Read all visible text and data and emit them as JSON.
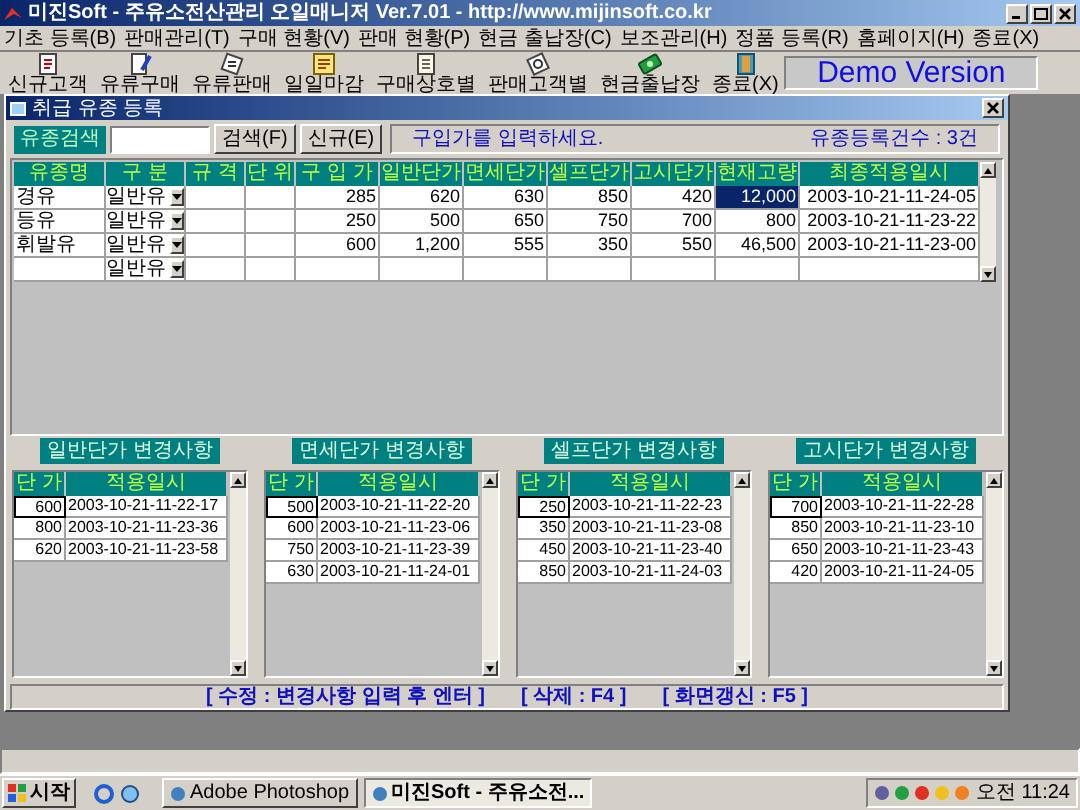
{
  "window": {
    "title": "미진Soft - 주유소전산관리 오일매니저 Ver.7.01 - http://www.mijinsoft.co.kr"
  },
  "menu": [
    "기초 등록(B)",
    "판매관리(T)",
    "구매 현황(V)",
    "판매 현황(P)",
    "현금 출납장(C)",
    "보조관리(H)",
    "정품 등록(R)",
    "홈페이지(H)",
    "종료(X)"
  ],
  "toolbar": {
    "buttons": [
      "신규고객",
      "유류구매",
      "유류판매",
      "일일마감",
      "구매상호별",
      "판매고객별",
      "현금출납장",
      "종료(X)"
    ],
    "banner": "Demo Version"
  },
  "child_window": {
    "title": "취급 유종 등록"
  },
  "search": {
    "label": "유종검색",
    "buttons": [
      "검색(F)",
      "신규(E)"
    ],
    "message": "구입가를 입력하세요.",
    "count": "유종등록건수 : 3건"
  },
  "table": {
    "columns": [
      "유종명",
      "구 분",
      "규 격",
      "단 위",
      "구 입 가",
      "일반단가",
      "면세단가",
      "셀프단가",
      "고시단가",
      "현재고량",
      "최종적용일시"
    ],
    "rows": [
      {
        "name": "경유",
        "type": "일반유",
        "purchase": "285",
        "general": "620",
        "taxfree": "630",
        "self": "850",
        "notice": "420",
        "stock": "12,000",
        "updated": "2003-10-21-11-24-05",
        "selected": true
      },
      {
        "name": "등유",
        "type": "일반유",
        "purchase": "250",
        "general": "500",
        "taxfree": "650",
        "self": "750",
        "notice": "700",
        "stock": "800",
        "updated": "2003-10-21-11-23-22",
        "selected": false
      },
      {
        "name": "휘발유",
        "type": "일반유",
        "purchase": "600",
        "general": "1,200",
        "taxfree": "555",
        "self": "350",
        "notice": "550",
        "stock": "46,500",
        "updated": "2003-10-21-11-23-00",
        "selected": false
      },
      {
        "type": "일반유",
        "selected": false
      }
    ]
  },
  "panels": [
    {
      "title": "일반단가 변경사항",
      "columns": [
        "단 가",
        "적용일시"
      ],
      "rows": [
        {
          "price": "600",
          "date": "2003-10-21-11-22-17",
          "focused": true
        },
        {
          "price": "800",
          "date": "2003-10-21-11-23-36",
          "focused": false
        },
        {
          "price": "620",
          "date": "2003-10-21-11-23-58",
          "focused": false
        }
      ]
    },
    {
      "title": "면세단가 변경사항",
      "columns": [
        "단 가",
        "적용일시"
      ],
      "rows": [
        {
          "price": "500",
          "date": "2003-10-21-11-22-20",
          "focused": true
        },
        {
          "price": "600",
          "date": "2003-10-21-11-23-06",
          "focused": false
        },
        {
          "price": "750",
          "date": "2003-10-21-11-23-39",
          "focused": false
        },
        {
          "price": "630",
          "date": "2003-10-21-11-24-01",
          "focused": false
        }
      ]
    },
    {
      "title": "셀프단가 변경사항",
      "columns": [
        "단 가",
        "적용일시"
      ],
      "rows": [
        {
          "price": "250",
          "date": "2003-10-21-11-22-23",
          "focused": true
        },
        {
          "price": "350",
          "date": "2003-10-21-11-23-08",
          "focused": false
        },
        {
          "price": "450",
          "date": "2003-10-21-11-23-40",
          "focused": false
        },
        {
          "price": "850",
          "date": "2003-10-21-11-24-03",
          "focused": false
        }
      ]
    },
    {
      "title": "고시단가 변경사항",
      "columns": [
        "단 가",
        "적용일시"
      ],
      "rows": [
        {
          "price": "700",
          "date": "2003-10-21-11-22-28",
          "focused": true
        },
        {
          "price": "850",
          "date": "2003-10-21-11-23-10",
          "focused": false
        },
        {
          "price": "650",
          "date": "2003-10-21-11-23-43",
          "focused": false
        },
        {
          "price": "420",
          "date": "2003-10-21-11-24-05",
          "focused": false
        }
      ]
    }
  ],
  "footer": [
    "[ 수정 : 변경사항 입력 후 엔터 ]",
    "[ 삭제 : F4 ]",
    "[ 화면갱신 : F5 ]"
  ],
  "taskbar": {
    "start": "시작",
    "tasks": [
      {
        "label": "Adobe Photoshop",
        "selected": false
      },
      {
        "label": "미진Soft - 주유소전...",
        "selected": true
      }
    ],
    "clock": "오전 11:24"
  }
}
